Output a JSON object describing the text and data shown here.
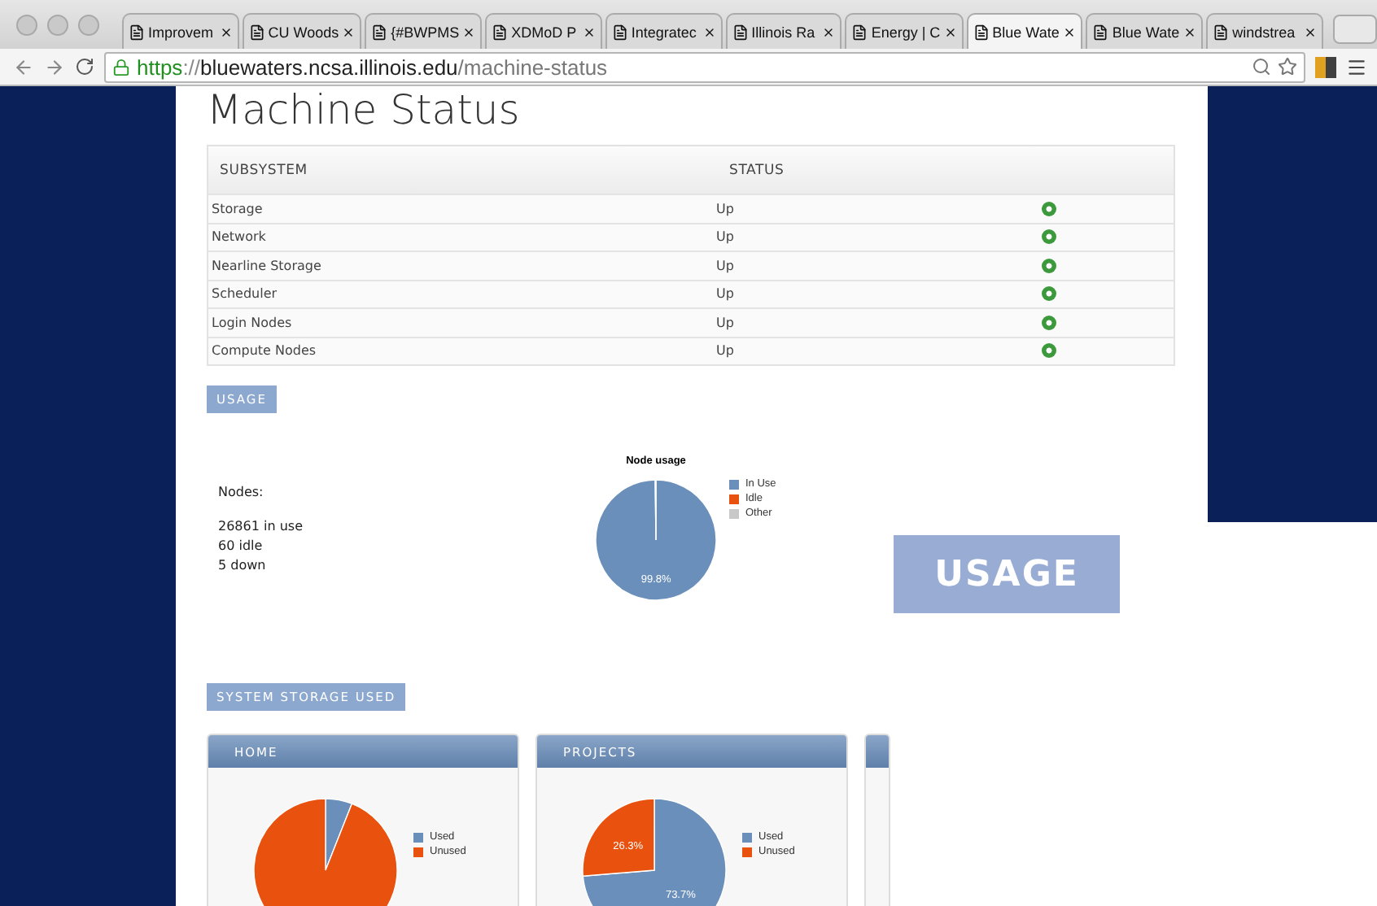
{
  "browser": {
    "tabs": [
      {
        "title": "Improvem",
        "selected": false
      },
      {
        "title": "CU Woods",
        "selected": false
      },
      {
        "title": "{#BWPMS",
        "selected": false
      },
      {
        "title": "XDMoD P",
        "selected": false
      },
      {
        "title": "Integratec",
        "selected": false
      },
      {
        "title": "Illinois Ra",
        "selected": false
      },
      {
        "title": "Energy | C",
        "selected": false
      },
      {
        "title": "Blue Wate",
        "selected": true
      },
      {
        "title": "Blue Wate",
        "selected": false
      },
      {
        "title": "windstrea",
        "selected": false
      }
    ],
    "url": {
      "scheme": "https",
      "separator": "://",
      "host": "bluewaters.ncsa.illinois.edu",
      "path": "/machine-status"
    }
  },
  "page": {
    "heading": "Machine Status",
    "status_table": {
      "columns": [
        "SUBSYSTEM",
        "STATUS"
      ],
      "rows": [
        {
          "subsystem": "Storage",
          "status": "Up",
          "ok": true
        },
        {
          "subsystem": "Network",
          "status": "Up",
          "ok": true
        },
        {
          "subsystem": "Nearline Storage",
          "status": "Up",
          "ok": true
        },
        {
          "subsystem": "Scheduler",
          "status": "Up",
          "ok": true
        },
        {
          "subsystem": "Login Nodes",
          "status": "Up",
          "ok": true
        },
        {
          "subsystem": "Compute Nodes",
          "status": "Up",
          "ok": true
        }
      ]
    },
    "usage": {
      "label": "USAGE",
      "nodes_title": "Nodes:",
      "node_lines": [
        "26861 in use",
        "60 idle",
        "5 down"
      ],
      "chart_data": {
        "type": "pie",
        "title": "Node usage",
        "categories": [
          "In Use",
          "Idle",
          "Other"
        ],
        "values": [
          99.8,
          0.2,
          0
        ],
        "value_labels": [
          "99.8%",
          null,
          null
        ]
      }
    },
    "storage": {
      "label": "SYSTEM STORAGE USED",
      "cards": [
        {
          "kind": "picture",
          "title": "HOME",
          "legend": [
            "Used",
            "Unused"
          ]
        },
        {
          "kind": "chart",
          "title": "PROJECTS",
          "chart_data": {
            "type": "pie",
            "categories": [
              "Used",
              "Unused"
            ],
            "values": [
              73.7,
              26.3
            ],
            "value_labels": [
              "73.7%",
              "26.3%"
            ]
          }
        },
        {
          "kind": "stub"
        }
      ]
    }
  },
  "callout": {
    "text": "USAGE"
  }
}
